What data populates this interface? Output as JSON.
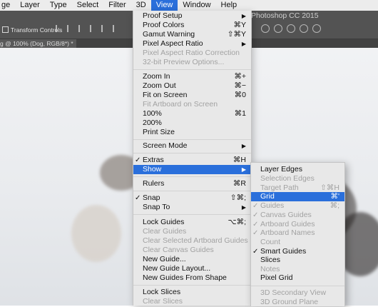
{
  "menubar": {
    "items": [
      "ge",
      "Layer",
      "Type",
      "Select",
      "Filter",
      "3D",
      "View",
      "Window",
      "Help"
    ],
    "active": "View"
  },
  "options_bar": {
    "app_title": "Photoshop CC 2015",
    "transform_controls": "Transform Controls"
  },
  "document_tab": {
    "title": "g @ 100% (Dog, RGB/8*) *"
  },
  "view_menu": {
    "items": [
      {
        "label": "Proof Setup",
        "arrow": "▶"
      },
      {
        "label": "Proof Colors",
        "shortcut": "⌘Y"
      },
      {
        "label": "Gamut Warning",
        "shortcut": "⇧⌘Y"
      },
      {
        "label": "Pixel Aspect Ratio",
        "arrow": "▶"
      },
      {
        "label": "Pixel Aspect Ratio Correction",
        "disabled": true
      },
      {
        "label": "32-bit Preview Options...",
        "disabled": true
      },
      {
        "label": "Zoom In",
        "shortcut": "⌘+"
      },
      {
        "label": "Zoom Out",
        "shortcut": "⌘−"
      },
      {
        "label": "Fit on Screen",
        "shortcut": "⌘0"
      },
      {
        "label": "Fit Artboard on Screen",
        "disabled": true
      },
      {
        "label": "100%",
        "shortcut": "⌘1"
      },
      {
        "label": "200%"
      },
      {
        "label": "Print Size"
      },
      {
        "label": "Screen Mode",
        "arrow": "▶"
      },
      {
        "label": "Extras",
        "shortcut": "⌘H",
        "check": "✓"
      },
      {
        "label": "Show",
        "arrow": "▶",
        "highlighted": true
      },
      {
        "label": "Rulers",
        "shortcut": "⌘R"
      },
      {
        "label": "Snap",
        "shortcut": "⇧⌘;",
        "check": "✓"
      },
      {
        "label": "Snap To",
        "arrow": "▶"
      },
      {
        "label": "Lock Guides",
        "shortcut": "⌥⌘;"
      },
      {
        "label": "Clear Guides",
        "disabled": true
      },
      {
        "label": "Clear Selected Artboard Guides",
        "disabled": true
      },
      {
        "label": "Clear Canvas Guides",
        "disabled": true
      },
      {
        "label": "New Guide..."
      },
      {
        "label": "New Guide Layout..."
      },
      {
        "label": "New Guides From Shape"
      },
      {
        "label": "Lock Slices"
      },
      {
        "label": "Clear Slices",
        "disabled": true
      }
    ]
  },
  "show_menu": {
    "items": [
      {
        "label": "Layer Edges"
      },
      {
        "label": "Selection Edges",
        "disabled": true
      },
      {
        "label": "Target Path",
        "shortcut": "⇧⌘H",
        "disabled": true
      },
      {
        "label": "Grid",
        "shortcut": "⌘'",
        "highlighted": true
      },
      {
        "label": "Guides",
        "shortcut": "⌘;",
        "check": "✓",
        "disabled": true
      },
      {
        "label": "Canvas Guides",
        "check": "✓",
        "disabled": true
      },
      {
        "label": "Artboard Guides",
        "check": "✓",
        "disabled": true
      },
      {
        "label": "Artboard Names",
        "check": "✓",
        "disabled": true
      },
      {
        "label": "Count",
        "disabled": true
      },
      {
        "label": "Smart Guides",
        "check": "✓"
      },
      {
        "label": "Slices"
      },
      {
        "label": "Notes",
        "disabled": true
      },
      {
        "label": "Pixel Grid"
      },
      {
        "label": "3D Secondary View",
        "disabled": true
      },
      {
        "label": "3D Ground Plane",
        "disabled": true
      }
    ]
  },
  "colors": {
    "highlight": "#2a6fdb",
    "menu_bg": "#e8e8e8",
    "toolbar_bg": "#535353"
  }
}
